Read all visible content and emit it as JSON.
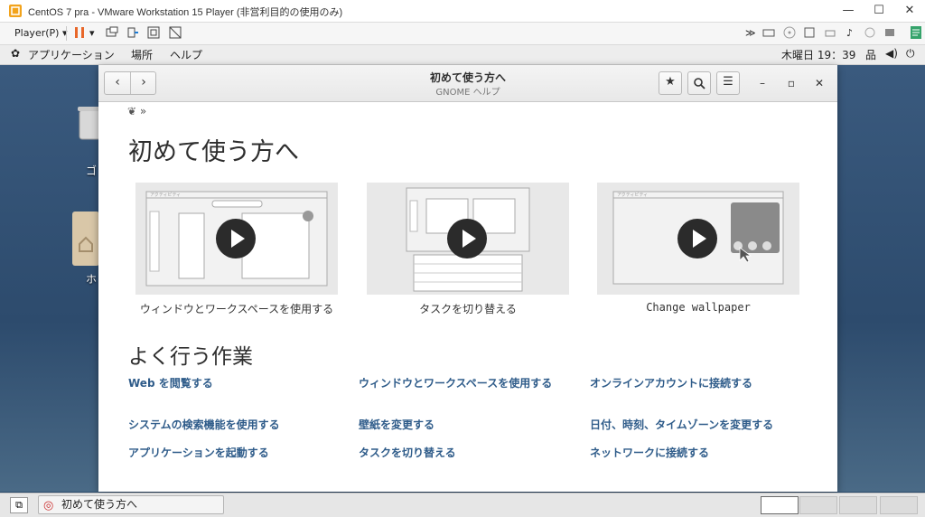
{
  "vmware": {
    "title": "CentOS 7 pra - VMware Workstation 15 Player (非営利目的の使用のみ)",
    "player_menu": "Player(P)",
    "controls": {
      "minimize": "—",
      "maximize": "☐",
      "close": "✕"
    }
  },
  "gnome_bar": {
    "applications": "アプリケーション",
    "places": "場所",
    "help": "ヘルプ",
    "clock": "木曜日 19：39"
  },
  "desktop": {
    "icons": [
      {
        "label": "ゴ",
        "icon": "trash-icon"
      },
      {
        "label": "ホ",
        "icon": "home-folder-icon"
      }
    ]
  },
  "help_window": {
    "title": "初めて使う方へ",
    "subtitle": "GNOME ヘルプ",
    "breadcrumb_sep": "»",
    "heading": "初めて使う方へ",
    "videos": [
      {
        "caption": "ウィンドウとワークスペースを使用する",
        "topbar_label": "アクティビティ"
      },
      {
        "caption": "タスクを切り替える",
        "topbar_label": ""
      },
      {
        "caption": "Change wallpaper",
        "topbar_label": "アクティビティ"
      }
    ],
    "common_tasks_heading": "よく行う作業",
    "links": [
      "Web を閲覧する",
      "ウィンドウとワークスペースを使用する",
      "オンラインアカウントに接続する",
      "システムの検索機能を使用する",
      "壁紙を変更する",
      "日付、時刻、タイムゾーンを変更する",
      "アプリケーションを起動する",
      "タスクを切り替える",
      "ネットワークに接続する"
    ]
  },
  "taskbar": {
    "window_label": "初めて使う方へ"
  }
}
